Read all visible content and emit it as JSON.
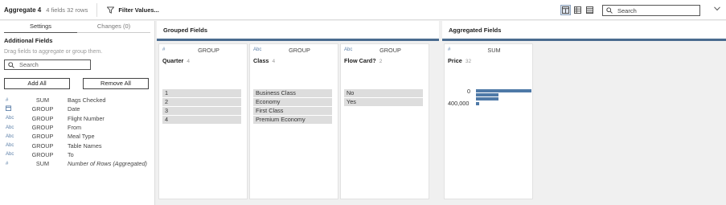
{
  "toolbar": {
    "title": "Aggregate 4",
    "meta": "4 fields  32 rows",
    "filter_label": "Filter Values...",
    "search_placeholder": "Search"
  },
  "left_panel": {
    "tabs": [
      {
        "label": "Settings"
      },
      {
        "label": "Changes (0)"
      }
    ],
    "section_title": "Additional Fields",
    "hint": "Drag fields to aggregate or group them.",
    "search_placeholder": "Search",
    "add_all_label": "Add All",
    "remove_all_label": "Remove All",
    "fields": [
      {
        "icon": "#",
        "agg": "SUM",
        "name": "Bags Checked"
      },
      {
        "icon": "calendar",
        "agg": "GROUP",
        "name": "Date"
      },
      {
        "icon": "Abc",
        "agg": "GROUP",
        "name": "Flight Number"
      },
      {
        "icon": "Abc",
        "agg": "GROUP",
        "name": "From"
      },
      {
        "icon": "Abc",
        "agg": "GROUP",
        "name": "Meal Type"
      },
      {
        "icon": "Abc",
        "agg": "GROUP",
        "name": "Table Names"
      },
      {
        "icon": "Abc",
        "agg": "GROUP",
        "name": "To"
      },
      {
        "icon": "#",
        "agg": "SUM",
        "name": "Number of Rows (Aggregated)"
      }
    ]
  },
  "grouped": {
    "title": "Grouped Fields",
    "cards": [
      {
        "icon": "#",
        "agg": "GROUP",
        "name": "Quarter",
        "count": "4",
        "values": [
          "1",
          "2",
          "3",
          "4"
        ]
      },
      {
        "icon": "Abc",
        "agg": "GROUP",
        "name": "Class",
        "count": "4",
        "values": [
          "Business Class",
          "Economy",
          "First Class",
          "Premium Economy"
        ]
      },
      {
        "icon": "Abc",
        "agg": "GROUP",
        "name": "Flow Card?",
        "count": "2",
        "values": [
          "No",
          "Yes"
        ]
      }
    ]
  },
  "aggregated": {
    "title": "Aggregated Fields",
    "card": {
      "icon": "#",
      "agg": "SUM",
      "name": "Price",
      "count": "32",
      "tick_zero": "0",
      "tick_max": "400,000"
    },
    "bar_color": "#4e79a7"
  },
  "colors": {
    "accent_bar": "#4a6b8f",
    "icon_blue": "#5b7fa8"
  }
}
